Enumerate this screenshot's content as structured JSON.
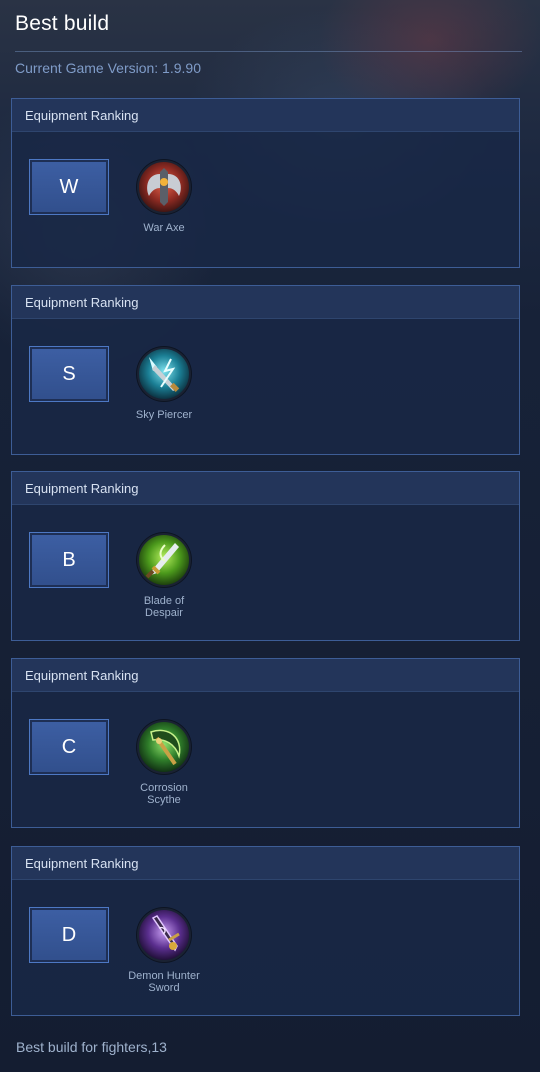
{
  "header": {
    "title": "Best build",
    "version_text": "Current Game Version: 1.9.90"
  },
  "cards": [
    {
      "title": "Equipment Ranking",
      "rank": "W",
      "item": {
        "name": "War Axe",
        "icon": "war-axe-icon",
        "color": "#b3362b"
      }
    },
    {
      "title": "Equipment Ranking",
      "rank": "S",
      "item": {
        "name": "Sky Piercer",
        "icon": "sky-piercer-icon",
        "color": "#1d9cb3"
      }
    },
    {
      "title": "Equipment Ranking",
      "rank": "B",
      "item": {
        "name": "Blade of Despair",
        "icon": "blade-of-despair-icon",
        "color": "#5fae23"
      }
    },
    {
      "title": "Equipment Ranking",
      "rank": "C",
      "item": {
        "name": "Corrosion Scythe",
        "icon": "corrosion-scythe-icon",
        "color": "#3e9a2c"
      }
    },
    {
      "title": "Equipment Ranking",
      "rank": "D",
      "item": {
        "name": "Demon Hunter Sword",
        "icon": "demon-hunter-sword-icon",
        "color": "#6f3fa3"
      }
    }
  ],
  "footer": {
    "text": "Best build for fighters,13"
  },
  "colors": {
    "accent": "#3d5fa4",
    "card_border": "#3d5d96",
    "muted_text": "#9fb2cd"
  }
}
